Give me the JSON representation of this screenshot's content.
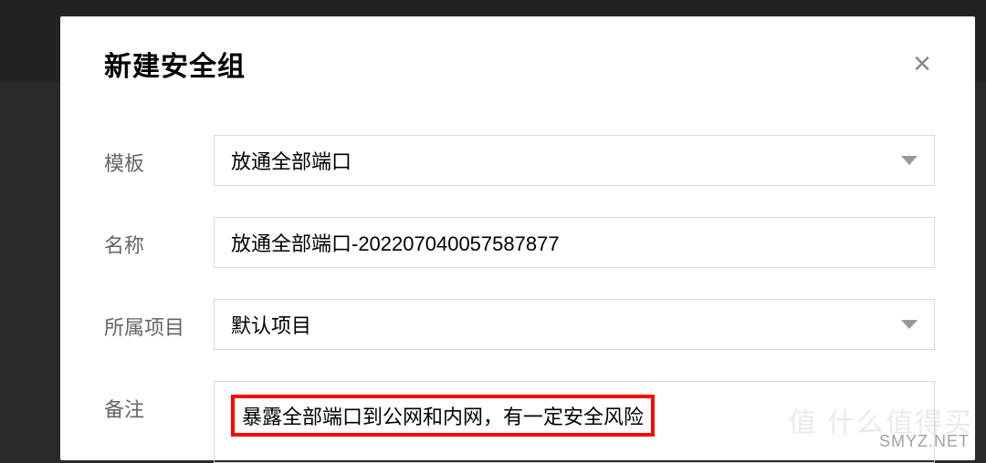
{
  "modal": {
    "title": "新建安全组",
    "close_label": "×"
  },
  "form": {
    "template": {
      "label": "模板",
      "value": "放通全部端口"
    },
    "name": {
      "label": "名称",
      "value": "放通全部端口-202207040057587877"
    },
    "project": {
      "label": "所属项目",
      "value": "默认项目"
    },
    "remark": {
      "label": "备注",
      "value": "暴露全部端口到公网和内网，有一定安全风险"
    }
  },
  "watermark": {
    "cn": "值 什么值得买",
    "en": "SMYZ.NET"
  }
}
